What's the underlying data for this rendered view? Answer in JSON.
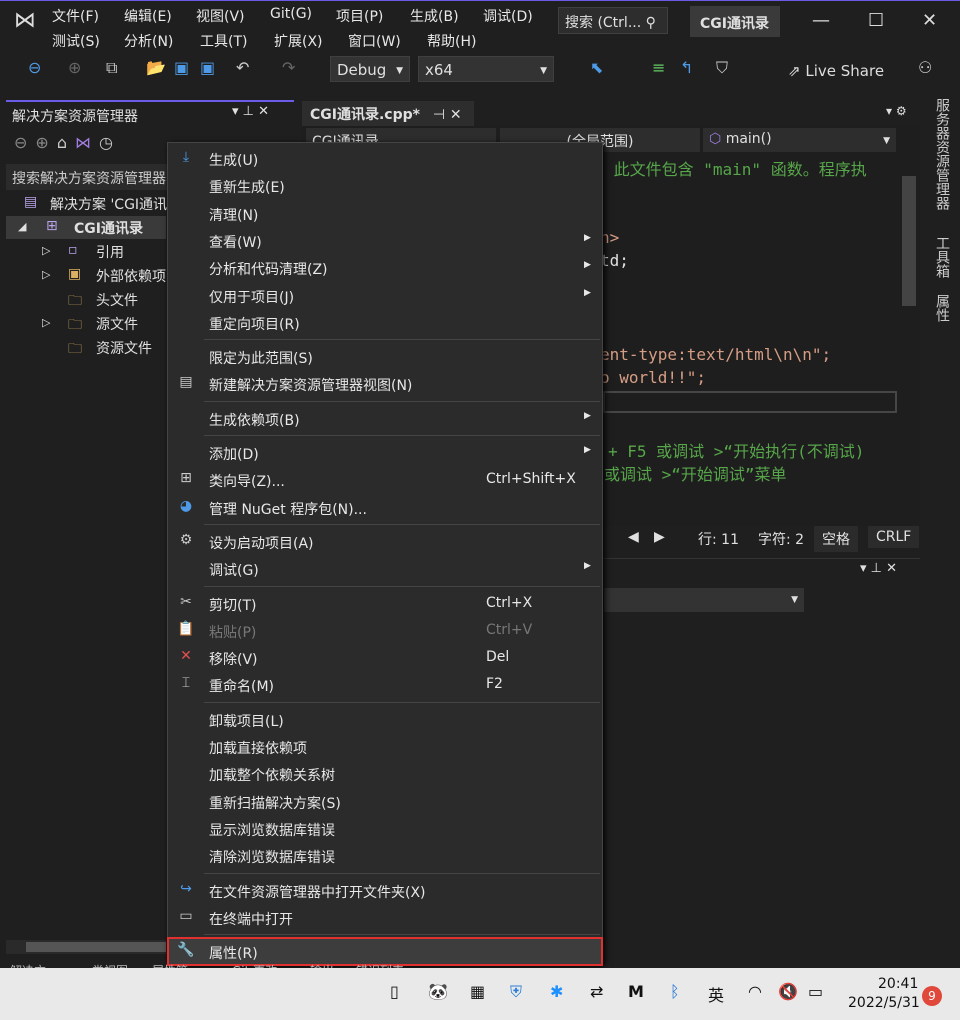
{
  "menubar": {
    "row1": [
      "文件(F)",
      "编辑(E)",
      "视图(V)",
      "Git(G)",
      "项目(P)",
      "生成(B)",
      "调试(D)"
    ],
    "row2": [
      "测试(S)",
      "分析(N)",
      "工具(T)",
      "扩展(X)",
      "窗口(W)",
      "帮助(H)"
    ]
  },
  "search": {
    "placeholder": "搜索 (Ctrl..."
  },
  "project_title": "CGI通讯录",
  "toolbar": {
    "config": "Debug",
    "platform": "x64",
    "live_share": "Live Share"
  },
  "solution_explorer": {
    "title": "解决方案资源管理器",
    "search_placeholder": "搜索解决方案资源管理器",
    "tree": [
      {
        "label": "解决方案 'CGI通讯",
        "expander": ""
      },
      {
        "label": "CGI通讯录",
        "expander": "◢"
      },
      {
        "label": "引用",
        "expander": "▷"
      },
      {
        "label": "外部依赖项",
        "expander": "▷"
      },
      {
        "label": "头文件",
        "expander": ""
      },
      {
        "label": "源文件",
        "expander": "▷"
      },
      {
        "label": "资源文件",
        "expander": ""
      }
    ]
  },
  "editor": {
    "tab": "CGI通讯录.cpp*",
    "nav_project": "CGI通讯录",
    "nav_scope": "(全局范围)",
    "nav_function": "main()",
    "lines": [
      {
        "text": " 此文件包含 \"main\" 函数。程序执",
        "color": "green"
      },
      {
        "text": "n>",
        "color": "orange"
      },
      {
        "text": "td;",
        "color": "plain"
      },
      {
        "text": "ent-type:text/html\\n\\n\";",
        "color": "orange"
      },
      {
        "text": "o world!!\";",
        "color": "orange"
      },
      {
        "text": "+ F5 或调试 >“开始执行(不调试)",
        "color": "green"
      },
      {
        "text": "或调试 >“开始调试”菜单",
        "color": "green"
      }
    ]
  },
  "status": {
    "line": "行: 11",
    "char": "字符: 2",
    "spaces": "空格",
    "eol": "CRLF"
  },
  "side_tabs": [
    "服务器资源管理器",
    "工具箱",
    "属性"
  ],
  "context_menu": [
    {
      "label": "生成(U)",
      "icon": "build-icon"
    },
    {
      "label": "重新生成(E)"
    },
    {
      "label": "清理(N)"
    },
    {
      "label": "查看(W)",
      "submenu": true
    },
    {
      "label": "分析和代码清理(Z)",
      "submenu": true
    },
    {
      "label": "仅用于项目(J)",
      "submenu": true
    },
    {
      "label": "重定向项目(R)"
    },
    {
      "separator": true
    },
    {
      "label": "限定为此范围(S)"
    },
    {
      "label": "新建解决方案资源管理器视图(N)",
      "icon": "new-view-icon"
    },
    {
      "separator": true
    },
    {
      "label": "生成依赖项(B)",
      "submenu": true
    },
    {
      "separator": true
    },
    {
      "label": "添加(D)",
      "submenu": true
    },
    {
      "label": "类向导(Z)...",
      "shortcut": "Ctrl+Shift+X",
      "icon": "class-wizard-icon"
    },
    {
      "label": "管理 NuGet 程序包(N)...",
      "icon": "nuget-icon"
    },
    {
      "separator": true
    },
    {
      "label": "设为启动项目(A)",
      "icon": "gear-icon"
    },
    {
      "label": "调试(G)",
      "submenu": true
    },
    {
      "separator": true
    },
    {
      "label": "剪切(T)",
      "shortcut": "Ctrl+X",
      "icon": "cut-icon"
    },
    {
      "label": "粘贴(P)",
      "shortcut": "Ctrl+V",
      "icon": "paste-icon",
      "disabled": true
    },
    {
      "label": "移除(V)",
      "shortcut": "Del",
      "icon": "remove-icon"
    },
    {
      "label": "重命名(M)",
      "shortcut": "F2",
      "icon": "rename-icon"
    },
    {
      "separator": true
    },
    {
      "label": "卸载项目(L)"
    },
    {
      "label": "加载直接依赖项"
    },
    {
      "label": "加载整个依赖关系树"
    },
    {
      "label": "重新扫描解决方案(S)"
    },
    {
      "label": "显示浏览数据库错误"
    },
    {
      "label": "清除浏览数据库错误"
    },
    {
      "separator": true
    },
    {
      "label": "在文件资源管理器中打开文件夹(X)",
      "icon": "open-folder-icon"
    },
    {
      "label": "在终端中打开",
      "icon": "terminal-icon"
    },
    {
      "separator": true
    },
    {
      "label": "属性(R)",
      "icon": "wrench-icon",
      "highlighted": true
    }
  ],
  "bottom_tabs": [
    "解决方...",
    "类视图",
    "属性管...",
    "Git 更改",
    "输出",
    "错误列表"
  ],
  "taskbar": {
    "ime": "英",
    "time": "20:41",
    "date": "2022/5/31",
    "badge": "9"
  }
}
